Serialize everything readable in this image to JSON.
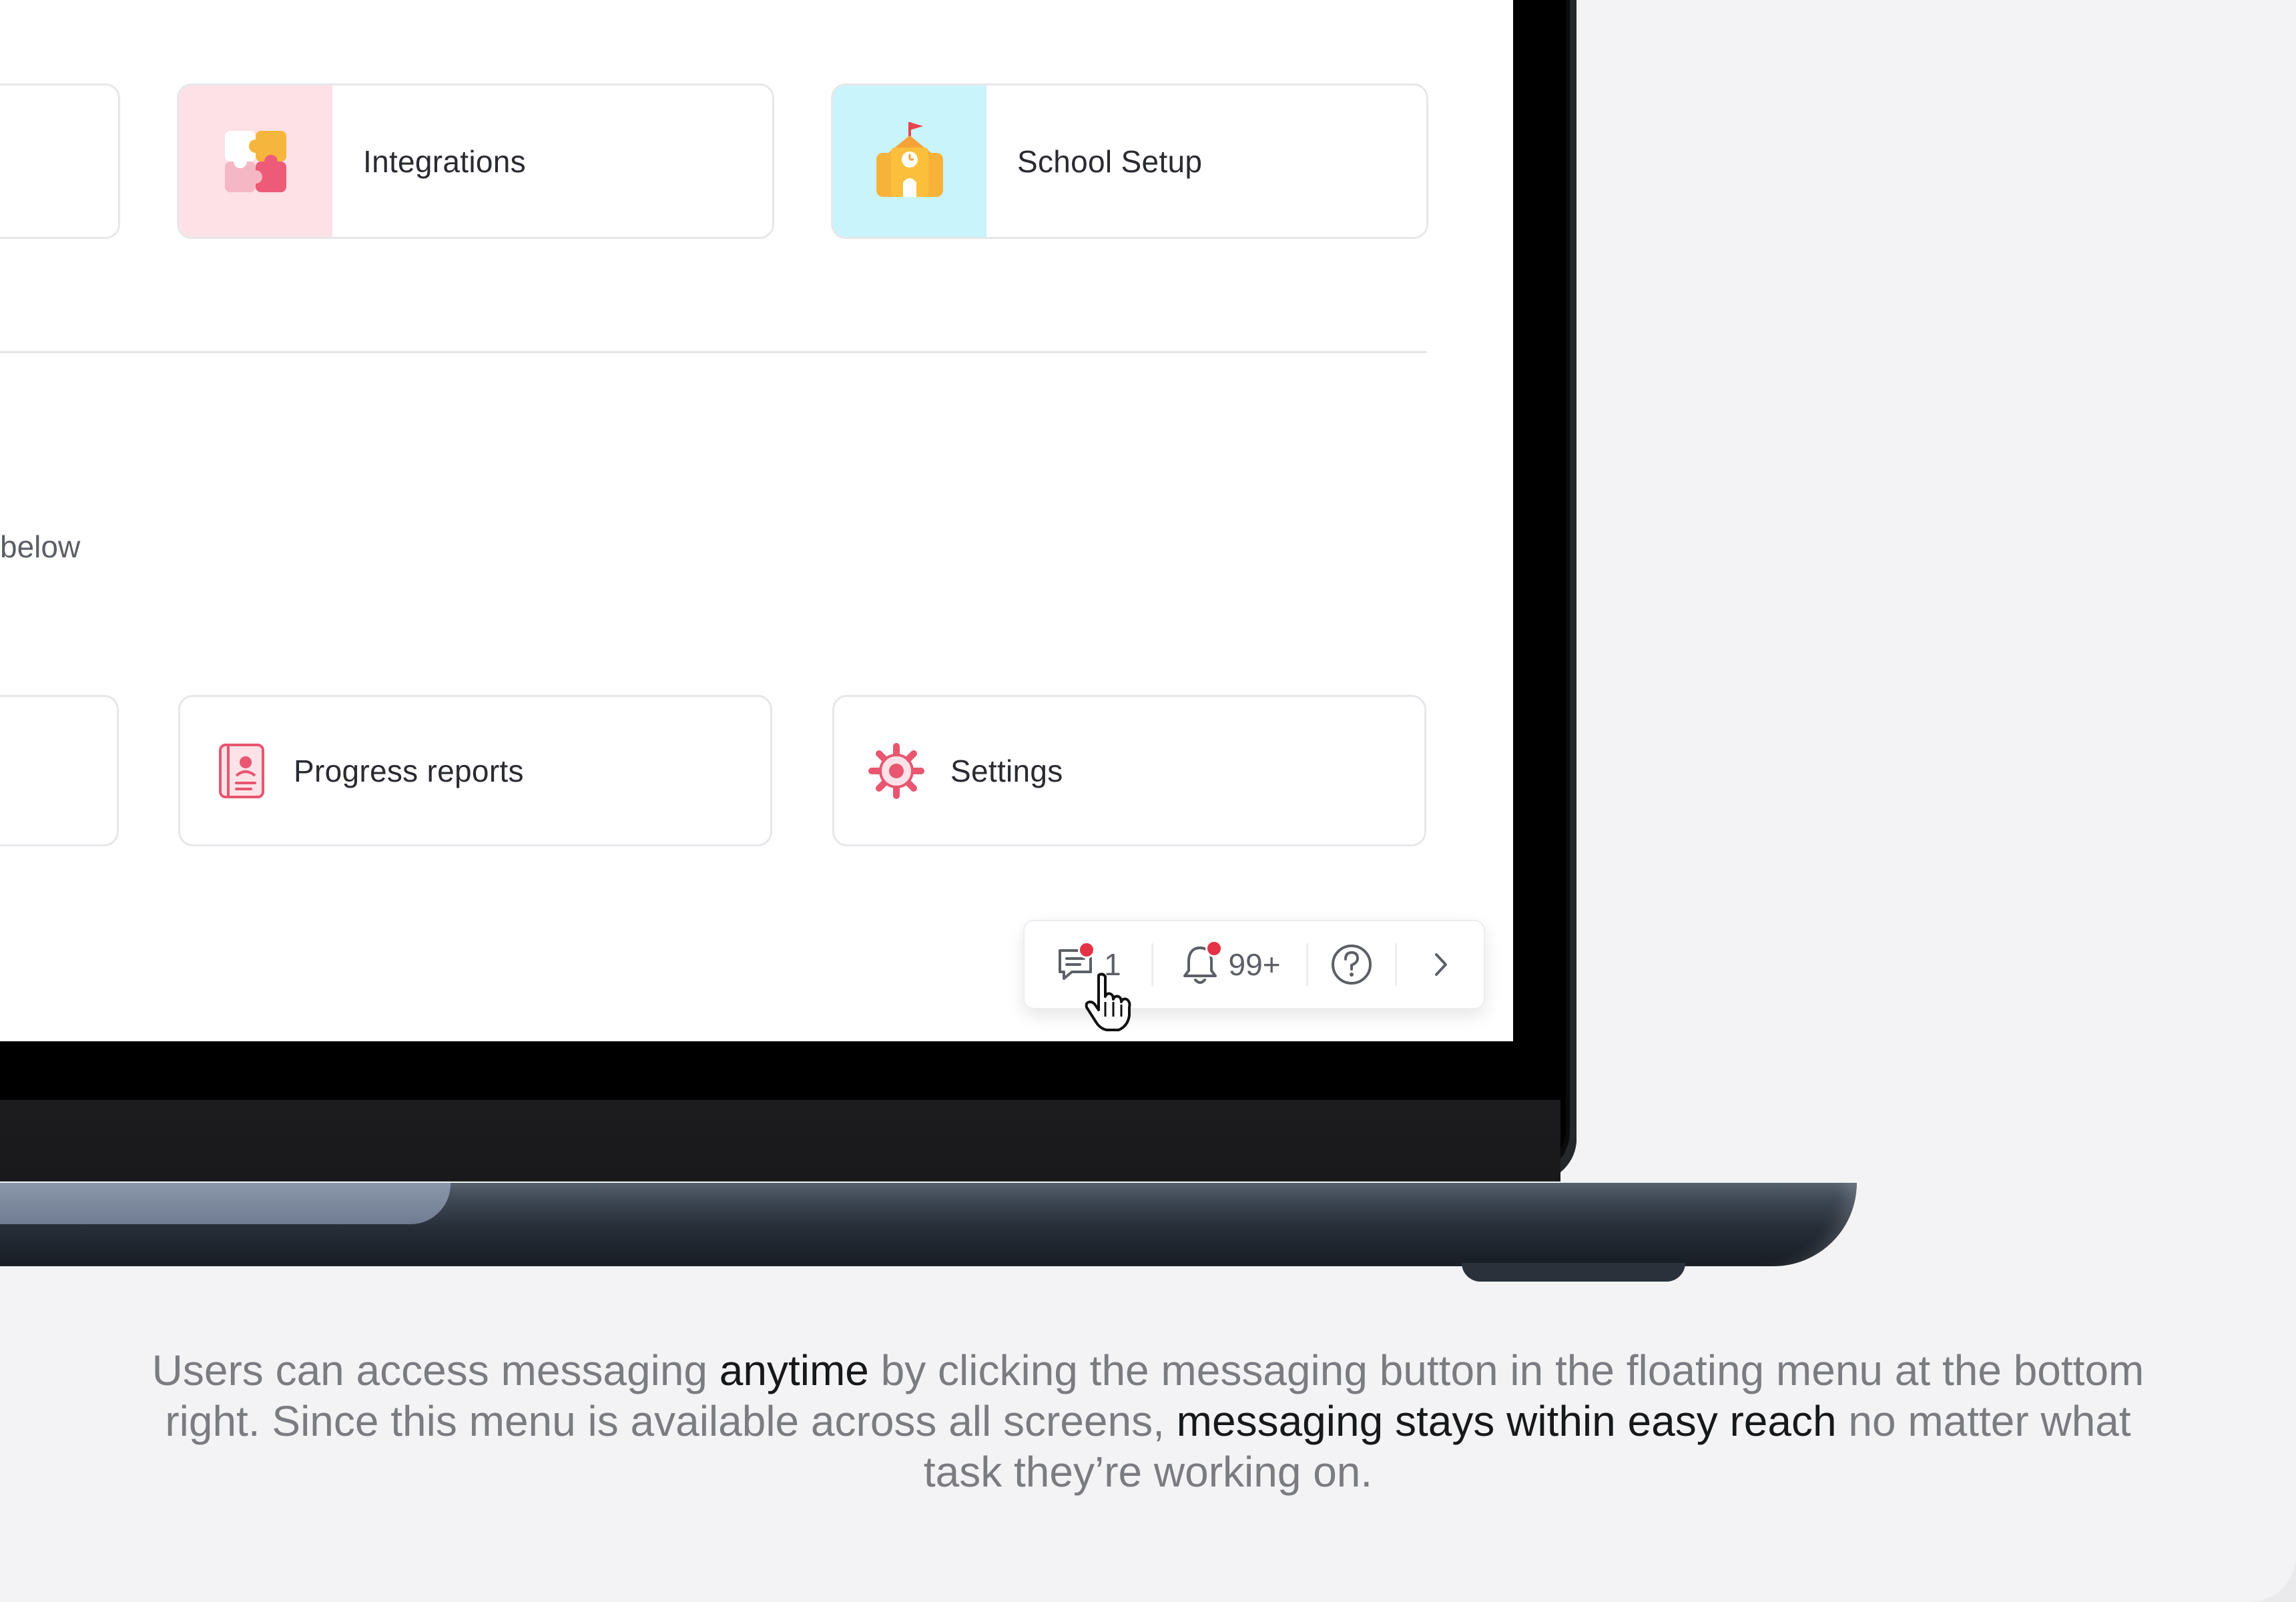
{
  "cards_top": [
    {
      "label": "Integrations",
      "icon": "puzzle-icon",
      "tile_color": "#fde1e6"
    },
    {
      "label": "School Setup",
      "icon": "school-building-icon",
      "tile_color": "#c9f4fb"
    }
  ],
  "section_hint": "below",
  "cards_bottom": [
    {
      "label": "Progress reports",
      "icon": "report-card-icon"
    },
    {
      "label": "Settings",
      "icon": "gear-icon"
    }
  ],
  "floating_menu": {
    "messages_count": "1",
    "notifications_count": "99+",
    "help_icon": "question-circle-icon",
    "expand_icon": "chevron-right-icon",
    "badge_color": "#e43247"
  },
  "caption": {
    "part1": "Users can access messaging ",
    "bold1": "anytime",
    "part2": " by clicking the messaging button in the floating menu at the bottom right. Since this menu is available across all screens, ",
    "bold2": "messaging stays within easy reach",
    "part3": " no matter what task they’re working on."
  }
}
